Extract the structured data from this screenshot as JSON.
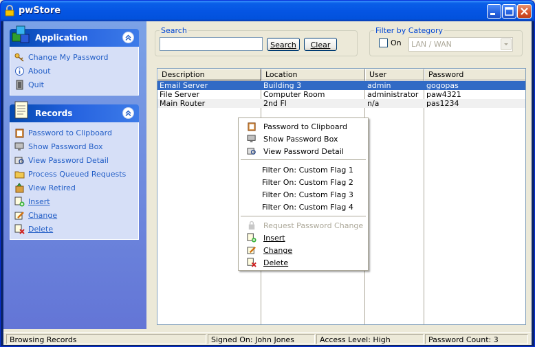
{
  "window": {
    "title": "pwStore"
  },
  "sidebar": {
    "application": {
      "title": "Application",
      "items": [
        {
          "label": "Change My Password",
          "icon": "key-icon"
        },
        {
          "label": "About",
          "icon": "info-icon"
        },
        {
          "label": "Quit",
          "icon": "exit-door-icon"
        }
      ]
    },
    "records": {
      "title": "Records",
      "items": [
        {
          "label": "Password to Clipboard",
          "icon": "clipboard-icon"
        },
        {
          "label": "Show Password Box",
          "icon": "monitor-icon"
        },
        {
          "label": "View Password Detail",
          "icon": "detail-view-icon"
        },
        {
          "label": "Process Queued Requests",
          "icon": "folder-icon"
        },
        {
          "label": "View Retired",
          "icon": "retired-box-icon"
        },
        {
          "label": "Insert",
          "icon": "insert-icon"
        },
        {
          "label": "Change",
          "icon": "edit-pencil-icon"
        },
        {
          "label": "Delete",
          "icon": "delete-icon"
        }
      ]
    }
  },
  "search": {
    "legend": "Search",
    "value": "",
    "search_label": "Search",
    "clear_label": "Clear"
  },
  "filter": {
    "legend": "Filter by Category",
    "on_label": "On",
    "category": "LAN / WAN"
  },
  "list": {
    "columns": [
      "Description",
      "Location",
      "User",
      "Password"
    ],
    "rows": [
      {
        "description": "Email Server",
        "location": "Building 3",
        "user": "admin",
        "password": "gogopas",
        "selected": true
      },
      {
        "description": "File Server",
        "location": "Computer Room",
        "user": "administrator",
        "password": "paw4321"
      },
      {
        "description": "Main Router",
        "location": "2nd Fl",
        "user": "n/a",
        "password": "pas1234"
      }
    ]
  },
  "context_menu": {
    "items": [
      "Password to Clipboard",
      "Show Password Box",
      "View Password Detail",
      "Filter On: Custom Flag 1",
      "Filter On: Custom Flag 2",
      "Filter On: Custom Flag 3",
      "Filter On: Custom Flag 4",
      "Request Password Change",
      "Insert",
      "Change",
      "Delete"
    ]
  },
  "status": {
    "message": "Browsing Records",
    "signed_on": "Signed On: John Jones",
    "access": "Access Level: High",
    "count": "Password Count: 3"
  },
  "colors": {
    "title_blue": "#0555e3",
    "link_blue": "#215dc6",
    "selection": "#316ac5",
    "legend_blue": "#0046d5"
  }
}
